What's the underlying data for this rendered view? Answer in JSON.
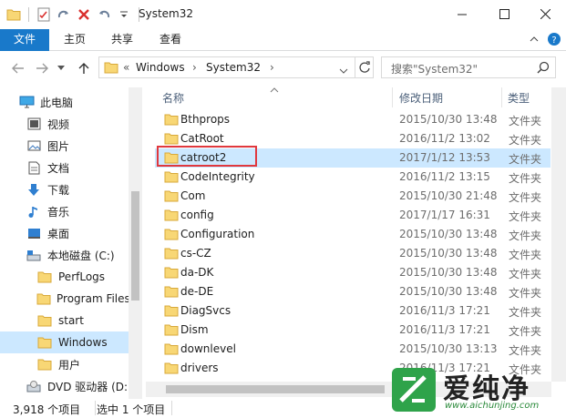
{
  "window": {
    "title": "System32"
  },
  "ribbon": {
    "tabs": [
      {
        "label": "文件"
      },
      {
        "label": "主页"
      },
      {
        "label": "共享"
      },
      {
        "label": "查看"
      }
    ]
  },
  "address": {
    "overflow": "«",
    "segments": [
      "Windows",
      "System32"
    ]
  },
  "search": {
    "placeholder": "搜索\"System32\""
  },
  "nav": {
    "items": [
      {
        "label": "此电脑",
        "icon": "computer-icon"
      },
      {
        "label": "视频",
        "icon": "video-icon"
      },
      {
        "label": "图片",
        "icon": "pictures-icon"
      },
      {
        "label": "文档",
        "icon": "documents-icon"
      },
      {
        "label": "下载",
        "icon": "download-icon"
      },
      {
        "label": "音乐",
        "icon": "music-icon"
      },
      {
        "label": "桌面",
        "icon": "desktop-icon"
      },
      {
        "label": "本地磁盘 (C:)",
        "icon": "drive-icon"
      },
      {
        "label": "PerfLogs",
        "icon": "folder-icon"
      },
      {
        "label": "Program Files",
        "icon": "folder-icon"
      },
      {
        "label": "start",
        "icon": "folder-icon"
      },
      {
        "label": "Windows",
        "icon": "folder-icon",
        "selected": true
      },
      {
        "label": "用户",
        "icon": "folder-icon"
      },
      {
        "label": "DVD 驱动器 (D:",
        "icon": "dvd-icon"
      }
    ]
  },
  "list": {
    "columns": {
      "name": "名称",
      "date": "修改日期",
      "type": "类型"
    },
    "rows": [
      {
        "name": "Bthprops",
        "date": "2015/10/30 13:48",
        "type": "文件夹"
      },
      {
        "name": "CatRoot",
        "date": "2016/11/2 13:02",
        "type": "文件夹"
      },
      {
        "name": "catroot2",
        "date": "2017/1/12 13:53",
        "type": "文件夹",
        "selected": true
      },
      {
        "name": "CodeIntegrity",
        "date": "2016/11/2 13:15",
        "type": "文件夹"
      },
      {
        "name": "Com",
        "date": "2015/10/30 21:48",
        "type": "文件夹"
      },
      {
        "name": "config",
        "date": "2017/1/17 16:31",
        "type": "文件夹"
      },
      {
        "name": "Configuration",
        "date": "2015/10/30 13:48",
        "type": "文件夹"
      },
      {
        "name": "cs-CZ",
        "date": "2015/10/30 13:48",
        "type": "文件夹"
      },
      {
        "name": "da-DK",
        "date": "2015/10/30 13:48",
        "type": "文件夹"
      },
      {
        "name": "de-DE",
        "date": "2015/10/30 13:48",
        "type": "文件夹"
      },
      {
        "name": "DiagSvcs",
        "date": "2016/11/3 17:21",
        "type": "文件夹"
      },
      {
        "name": "Dism",
        "date": "2016/11/3 17:21",
        "type": "文件夹"
      },
      {
        "name": "downlevel",
        "date": "2015/10/30 13:13",
        "type": "文件夹"
      },
      {
        "name": "drivers",
        "date": "2016/11/3 17:21",
        "type": "文件夹"
      }
    ]
  },
  "status": {
    "count": "3,918 个项目",
    "selected": "选中 1 个项目"
  },
  "watermark": {
    "text": "爱纯净",
    "url": "www.aichunjing.com"
  },
  "colors": {
    "accent": "#1979ca",
    "selection": "#cce8ff",
    "highlight": "#e0383e",
    "folder": "#f8d775"
  }
}
